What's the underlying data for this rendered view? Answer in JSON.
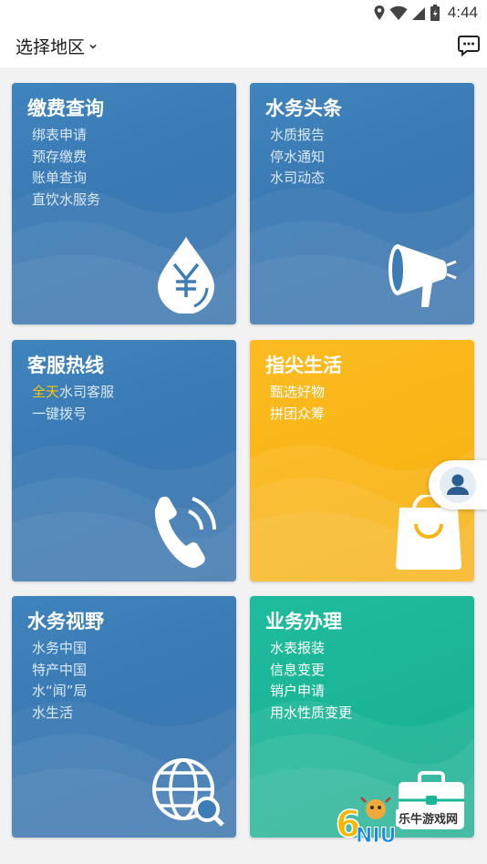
{
  "status_bar": {
    "time": "4:44"
  },
  "header": {
    "region_label": "选择地区"
  },
  "cards": {
    "payment": {
      "title": "缴费查询",
      "items": [
        "绑表申请",
        "预存缴费",
        "账单查询",
        "直饮水服务"
      ]
    },
    "news": {
      "title": "水务头条",
      "items": [
        "水质报告",
        "停水通知",
        "水司动态"
      ]
    },
    "hotline": {
      "title": "客服热线",
      "item1_highlight": "全天",
      "item1_rest": "水司客服",
      "item2": "一键拨号"
    },
    "life": {
      "title": "指尖生活",
      "items": [
        "甄选好物",
        "拼团众筹"
      ]
    },
    "vision": {
      "title": "水务视野",
      "items": [
        "水务中国",
        "特产中国",
        "水“闻”局",
        "水生活"
      ]
    },
    "business": {
      "title": "业务办理",
      "items": [
        "水表报装",
        "信息变更",
        "销户申请",
        "用水性质变更"
      ]
    }
  },
  "watermark": {
    "text": "乐牛游戏网",
    "logo": "6NIU"
  },
  "colors": {
    "blue": "#3c7db8",
    "orange": "#f9b515",
    "teal": "#1bb597",
    "highlight": "#ffc400"
  }
}
